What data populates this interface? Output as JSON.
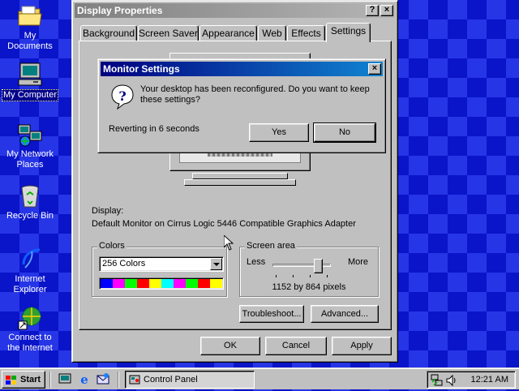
{
  "desktop": {
    "icons": [
      {
        "label1": "My Documents",
        "label2": "",
        "icon": "my-documents-icon"
      },
      {
        "label1": "My Computer",
        "label2": "",
        "icon": "my-computer-icon"
      },
      {
        "label1": "My Network",
        "label2": "Places",
        "icon": "network-places-icon"
      },
      {
        "label1": "Recycle Bin",
        "label2": "",
        "icon": "recycle-bin-icon"
      },
      {
        "label1": "Internet",
        "label2": "Explorer",
        "icon": "internet-explorer-icon"
      },
      {
        "label1": "Connect to",
        "label2": "the Internet",
        "icon": "connect-internet-icon"
      }
    ]
  },
  "display_properties": {
    "title": "Display Properties",
    "help_glyph": "?",
    "close_glyph": "×",
    "tabs": [
      "Background",
      "Screen Saver",
      "Appearance",
      "Web",
      "Effects",
      "Settings"
    ],
    "active_tab": "Settings",
    "display_label": "Display:",
    "display_value": "Default Monitor on Cirrus Logic 5446 Compatible Graphics Adapter",
    "colors": {
      "legend": "Colors",
      "selected": "256 Colors",
      "palette": [
        "#0000ff",
        "#ff00ff",
        "#00ff00",
        "#ff0000",
        "#ffff00",
        "#00ffff",
        "#ff00ff",
        "#00ff00",
        "#ff0000",
        "#ffff00"
      ]
    },
    "screen_area": {
      "legend": "Screen area",
      "less": "Less",
      "more": "More",
      "value": "1152 by 864 pixels",
      "slider_position": 0.83
    },
    "troubleshoot_label": "Troubleshoot...",
    "advanced_label": "Advanced...",
    "ok_label": "OK",
    "cancel_label": "Cancel",
    "apply_label": "Apply"
  },
  "monitor_settings": {
    "title": "Monitor Settings",
    "close_glyph": "×",
    "message": "Your desktop has been reconfigured.  Do you want to keep these settings?",
    "countdown": "Reverting in 6 seconds",
    "yes_label": "Yes",
    "no_label": "No",
    "icon": "question-icon"
  },
  "taskbar": {
    "start_label": "Start",
    "quicklaunch": [
      "show-desktop-icon",
      "internet-explorer-icon",
      "outlook-express-icon"
    ],
    "tasks": [
      {
        "label": "Control Panel",
        "icon": "control-panel-icon"
      }
    ],
    "clock": "12:21 AM",
    "tray": [
      "network-tray-icon",
      "volume-icon"
    ]
  },
  "colors": {
    "desktop_bg": "#0a14c8",
    "title_active": "#000080",
    "title_inactive": "#808080",
    "face": "#c0c0c0"
  }
}
